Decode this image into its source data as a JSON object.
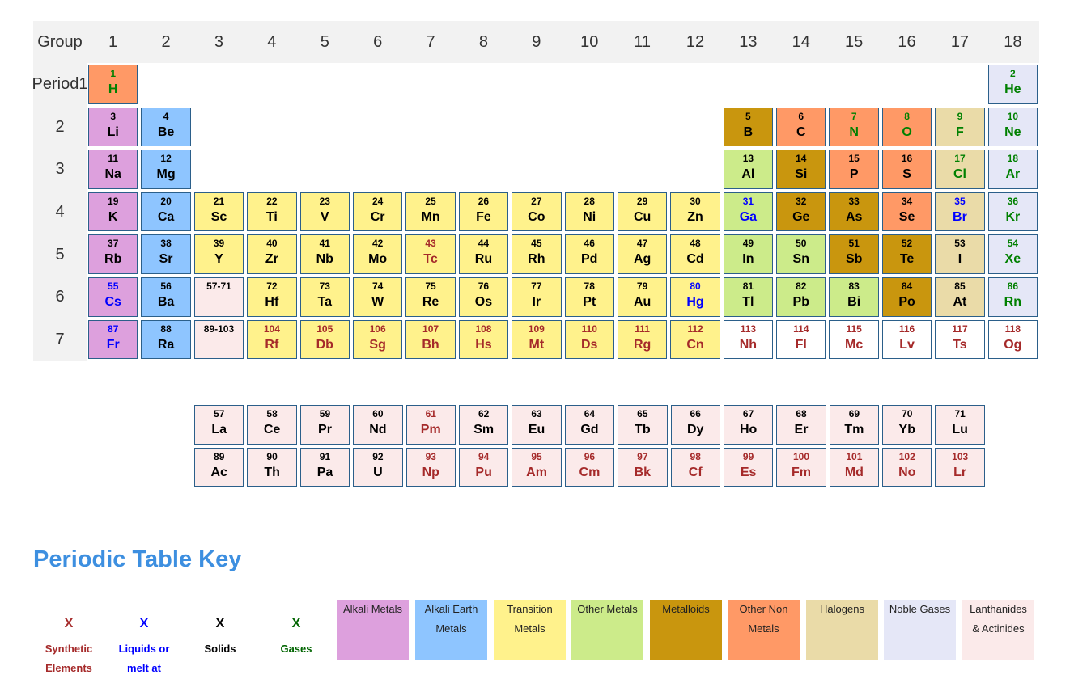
{
  "header": {
    "group_label": "Group",
    "period_label": "Period"
  },
  "groups": [
    "1",
    "2",
    "3",
    "4",
    "5",
    "6",
    "7",
    "8",
    "9",
    "10",
    "11",
    "12",
    "13",
    "14",
    "15",
    "16",
    "17",
    "18"
  ],
  "periods": [
    "1",
    "2",
    "3",
    "4",
    "5",
    "6",
    "7"
  ],
  "category_colors": {
    "alkali": "#dda0dd",
    "alkaline": "#8ec5ff",
    "transition": "#fff28c",
    "other_metal": "#cceb8a",
    "metalloid": "#c9960e",
    "nonmetal": "#ff9966",
    "halogen": "#eadba8",
    "noble": "#e5e7f7",
    "lanthanide": "#fbeaea",
    "synthetic_cell": "#ffffff"
  },
  "state_colors": {
    "solid": "#000000",
    "liquid": "#0000ff",
    "gas": "#008000",
    "synthetic": "#a52a2a"
  },
  "elements": [
    {
      "n": "1",
      "s": "H",
      "g": 1,
      "p": 1,
      "c": "nonmetal",
      "st": "gas"
    },
    {
      "n": "2",
      "s": "He",
      "g": 18,
      "p": 1,
      "c": "noble",
      "st": "gas"
    },
    {
      "n": "3",
      "s": "Li",
      "g": 1,
      "p": 2,
      "c": "alkali",
      "st": "solid"
    },
    {
      "n": "4",
      "s": "Be",
      "g": 2,
      "p": 2,
      "c": "alkaline",
      "st": "solid"
    },
    {
      "n": "5",
      "s": "B",
      "g": 13,
      "p": 2,
      "c": "metalloid",
      "st": "solid"
    },
    {
      "n": "6",
      "s": "C",
      "g": 14,
      "p": 2,
      "c": "nonmetal",
      "st": "solid"
    },
    {
      "n": "7",
      "s": "N",
      "g": 15,
      "p": 2,
      "c": "nonmetal",
      "st": "gas"
    },
    {
      "n": "8",
      "s": "O",
      "g": 16,
      "p": 2,
      "c": "nonmetal",
      "st": "gas"
    },
    {
      "n": "9",
      "s": "F",
      "g": 17,
      "p": 2,
      "c": "halogen",
      "st": "gas"
    },
    {
      "n": "10",
      "s": "Ne",
      "g": 18,
      "p": 2,
      "c": "noble",
      "st": "gas"
    },
    {
      "n": "11",
      "s": "Na",
      "g": 1,
      "p": 3,
      "c": "alkali",
      "st": "solid"
    },
    {
      "n": "12",
      "s": "Mg",
      "g": 2,
      "p": 3,
      "c": "alkaline",
      "st": "solid"
    },
    {
      "n": "13",
      "s": "Al",
      "g": 13,
      "p": 3,
      "c": "other_metal",
      "st": "solid"
    },
    {
      "n": "14",
      "s": "Si",
      "g": 14,
      "p": 3,
      "c": "metalloid",
      "st": "solid"
    },
    {
      "n": "15",
      "s": "P",
      "g": 15,
      "p": 3,
      "c": "nonmetal",
      "st": "solid"
    },
    {
      "n": "16",
      "s": "S",
      "g": 16,
      "p": 3,
      "c": "nonmetal",
      "st": "solid"
    },
    {
      "n": "17",
      "s": "Cl",
      "g": 17,
      "p": 3,
      "c": "halogen",
      "st": "gas"
    },
    {
      "n": "18",
      "s": "Ar",
      "g": 18,
      "p": 3,
      "c": "noble",
      "st": "gas"
    },
    {
      "n": "19",
      "s": "K",
      "g": 1,
      "p": 4,
      "c": "alkali",
      "st": "solid"
    },
    {
      "n": "20",
      "s": "Ca",
      "g": 2,
      "p": 4,
      "c": "alkaline",
      "st": "solid"
    },
    {
      "n": "21",
      "s": "Sc",
      "g": 3,
      "p": 4,
      "c": "transition",
      "st": "solid"
    },
    {
      "n": "22",
      "s": "Ti",
      "g": 4,
      "p": 4,
      "c": "transition",
      "st": "solid"
    },
    {
      "n": "23",
      "s": "V",
      "g": 5,
      "p": 4,
      "c": "transition",
      "st": "solid"
    },
    {
      "n": "24",
      "s": "Cr",
      "g": 6,
      "p": 4,
      "c": "transition",
      "st": "solid"
    },
    {
      "n": "25",
      "s": "Mn",
      "g": 7,
      "p": 4,
      "c": "transition",
      "st": "solid"
    },
    {
      "n": "26",
      "s": "Fe",
      "g": 8,
      "p": 4,
      "c": "transition",
      "st": "solid"
    },
    {
      "n": "27",
      "s": "Co",
      "g": 9,
      "p": 4,
      "c": "transition",
      "st": "solid"
    },
    {
      "n": "28",
      "s": "Ni",
      "g": 10,
      "p": 4,
      "c": "transition",
      "st": "solid"
    },
    {
      "n": "29",
      "s": "Cu",
      "g": 11,
      "p": 4,
      "c": "transition",
      "st": "solid"
    },
    {
      "n": "30",
      "s": "Zn",
      "g": 12,
      "p": 4,
      "c": "transition",
      "st": "solid"
    },
    {
      "n": "31",
      "s": "Ga",
      "g": 13,
      "p": 4,
      "c": "other_metal",
      "st": "liquid"
    },
    {
      "n": "32",
      "s": "Ge",
      "g": 14,
      "p": 4,
      "c": "metalloid",
      "st": "solid"
    },
    {
      "n": "33",
      "s": "As",
      "g": 15,
      "p": 4,
      "c": "metalloid",
      "st": "solid"
    },
    {
      "n": "34",
      "s": "Se",
      "g": 16,
      "p": 4,
      "c": "nonmetal",
      "st": "solid"
    },
    {
      "n": "35",
      "s": "Br",
      "g": 17,
      "p": 4,
      "c": "halogen",
      "st": "liquid"
    },
    {
      "n": "36",
      "s": "Kr",
      "g": 18,
      "p": 4,
      "c": "noble",
      "st": "gas"
    },
    {
      "n": "37",
      "s": "Rb",
      "g": 1,
      "p": 5,
      "c": "alkali",
      "st": "solid"
    },
    {
      "n": "38",
      "s": "Sr",
      "g": 2,
      "p": 5,
      "c": "alkaline",
      "st": "solid"
    },
    {
      "n": "39",
      "s": "Y",
      "g": 3,
      "p": 5,
      "c": "transition",
      "st": "solid"
    },
    {
      "n": "40",
      "s": "Zr",
      "g": 4,
      "p": 5,
      "c": "transition",
      "st": "solid"
    },
    {
      "n": "41",
      "s": "Nb",
      "g": 5,
      "p": 5,
      "c": "transition",
      "st": "solid"
    },
    {
      "n": "42",
      "s": "Mo",
      "g": 6,
      "p": 5,
      "c": "transition",
      "st": "solid"
    },
    {
      "n": "43",
      "s": "Tc",
      "g": 7,
      "p": 5,
      "c": "transition",
      "st": "synthetic"
    },
    {
      "n": "44",
      "s": "Ru",
      "g": 8,
      "p": 5,
      "c": "transition",
      "st": "solid"
    },
    {
      "n": "45",
      "s": "Rh",
      "g": 9,
      "p": 5,
      "c": "transition",
      "st": "solid"
    },
    {
      "n": "46",
      "s": "Pd",
      "g": 10,
      "p": 5,
      "c": "transition",
      "st": "solid"
    },
    {
      "n": "47",
      "s": "Ag",
      "g": 11,
      "p": 5,
      "c": "transition",
      "st": "solid"
    },
    {
      "n": "48",
      "s": "Cd",
      "g": 12,
      "p": 5,
      "c": "transition",
      "st": "solid"
    },
    {
      "n": "49",
      "s": "In",
      "g": 13,
      "p": 5,
      "c": "other_metal",
      "st": "solid"
    },
    {
      "n": "50",
      "s": "Sn",
      "g": 14,
      "p": 5,
      "c": "other_metal",
      "st": "solid"
    },
    {
      "n": "51",
      "s": "Sb",
      "g": 15,
      "p": 5,
      "c": "metalloid",
      "st": "solid"
    },
    {
      "n": "52",
      "s": "Te",
      "g": 16,
      "p": 5,
      "c": "metalloid",
      "st": "solid"
    },
    {
      "n": "53",
      "s": "I",
      "g": 17,
      "p": 5,
      "c": "halogen",
      "st": "solid"
    },
    {
      "n": "54",
      "s": "Xe",
      "g": 18,
      "p": 5,
      "c": "noble",
      "st": "gas"
    },
    {
      "n": "55",
      "s": "Cs",
      "g": 1,
      "p": 6,
      "c": "alkali",
      "st": "liquid"
    },
    {
      "n": "56",
      "s": "Ba",
      "g": 2,
      "p": 6,
      "c": "alkaline",
      "st": "solid"
    },
    {
      "n": "57-71",
      "s": "",
      "g": 3,
      "p": 6,
      "c": "lanthanide",
      "st": "solid"
    },
    {
      "n": "72",
      "s": "Hf",
      "g": 4,
      "p": 6,
      "c": "transition",
      "st": "solid"
    },
    {
      "n": "73",
      "s": "Ta",
      "g": 5,
      "p": 6,
      "c": "transition",
      "st": "solid"
    },
    {
      "n": "74",
      "s": "W",
      "g": 6,
      "p": 6,
      "c": "transition",
      "st": "solid"
    },
    {
      "n": "75",
      "s": "Re",
      "g": 7,
      "p": 6,
      "c": "transition",
      "st": "solid"
    },
    {
      "n": "76",
      "s": "Os",
      "g": 8,
      "p": 6,
      "c": "transition",
      "st": "solid"
    },
    {
      "n": "77",
      "s": "Ir",
      "g": 9,
      "p": 6,
      "c": "transition",
      "st": "solid"
    },
    {
      "n": "78",
      "s": "Pt",
      "g": 10,
      "p": 6,
      "c": "transition",
      "st": "solid"
    },
    {
      "n": "79",
      "s": "Au",
      "g": 11,
      "p": 6,
      "c": "transition",
      "st": "solid"
    },
    {
      "n": "80",
      "s": "Hg",
      "g": 12,
      "p": 6,
      "c": "transition",
      "st": "liquid"
    },
    {
      "n": "81",
      "s": "Tl",
      "g": 13,
      "p": 6,
      "c": "other_metal",
      "st": "solid"
    },
    {
      "n": "82",
      "s": "Pb",
      "g": 14,
      "p": 6,
      "c": "other_metal",
      "st": "solid"
    },
    {
      "n": "83",
      "s": "Bi",
      "g": 15,
      "p": 6,
      "c": "other_metal",
      "st": "solid"
    },
    {
      "n": "84",
      "s": "Po",
      "g": 16,
      "p": 6,
      "c": "metalloid",
      "st": "solid"
    },
    {
      "n": "85",
      "s": "At",
      "g": 17,
      "p": 6,
      "c": "halogen",
      "st": "solid"
    },
    {
      "n": "86",
      "s": "Rn",
      "g": 18,
      "p": 6,
      "c": "noble",
      "st": "gas"
    },
    {
      "n": "87",
      "s": "Fr",
      "g": 1,
      "p": 7,
      "c": "alkali",
      "st": "liquid"
    },
    {
      "n": "88",
      "s": "Ra",
      "g": 2,
      "p": 7,
      "c": "alkaline",
      "st": "solid"
    },
    {
      "n": "89-103",
      "s": "",
      "g": 3,
      "p": 7,
      "c": "lanthanide",
      "st": "solid"
    },
    {
      "n": "104",
      "s": "Rf",
      "g": 4,
      "p": 7,
      "c": "transition",
      "st": "synthetic"
    },
    {
      "n": "105",
      "s": "Db",
      "g": 5,
      "p": 7,
      "c": "transition",
      "st": "synthetic"
    },
    {
      "n": "106",
      "s": "Sg",
      "g": 6,
      "p": 7,
      "c": "transition",
      "st": "synthetic"
    },
    {
      "n": "107",
      "s": "Bh",
      "g": 7,
      "p": 7,
      "c": "transition",
      "st": "synthetic"
    },
    {
      "n": "108",
      "s": "Hs",
      "g": 8,
      "p": 7,
      "c": "transition",
      "st": "synthetic"
    },
    {
      "n": "109",
      "s": "Mt",
      "g": 9,
      "p": 7,
      "c": "transition",
      "st": "synthetic"
    },
    {
      "n": "110",
      "s": "Ds",
      "g": 10,
      "p": 7,
      "c": "transition",
      "st": "synthetic"
    },
    {
      "n": "111",
      "s": "Rg",
      "g": 11,
      "p": 7,
      "c": "transition",
      "st": "synthetic"
    },
    {
      "n": "112",
      "s": "Cn",
      "g": 12,
      "p": 7,
      "c": "transition",
      "st": "synthetic"
    },
    {
      "n": "113",
      "s": "Nh",
      "g": 13,
      "p": 7,
      "c": "synthetic_cell",
      "st": "synthetic"
    },
    {
      "n": "114",
      "s": "Fl",
      "g": 14,
      "p": 7,
      "c": "synthetic_cell",
      "st": "synthetic"
    },
    {
      "n": "115",
      "s": "Mc",
      "g": 15,
      "p": 7,
      "c": "synthetic_cell",
      "st": "synthetic"
    },
    {
      "n": "116",
      "s": "Lv",
      "g": 16,
      "p": 7,
      "c": "synthetic_cell",
      "st": "synthetic"
    },
    {
      "n": "117",
      "s": "Ts",
      "g": 17,
      "p": 7,
      "c": "synthetic_cell",
      "st": "synthetic"
    },
    {
      "n": "118",
      "s": "Og",
      "g": 18,
      "p": 7,
      "c": "synthetic_cell",
      "st": "synthetic"
    }
  ],
  "lanthanides": [
    {
      "n": "57",
      "s": "La",
      "st": "solid"
    },
    {
      "n": "58",
      "s": "Ce",
      "st": "solid"
    },
    {
      "n": "59",
      "s": "Pr",
      "st": "solid"
    },
    {
      "n": "60",
      "s": "Nd",
      "st": "solid"
    },
    {
      "n": "61",
      "s": "Pm",
      "st": "synthetic"
    },
    {
      "n": "62",
      "s": "Sm",
      "st": "solid"
    },
    {
      "n": "63",
      "s": "Eu",
      "st": "solid"
    },
    {
      "n": "64",
      "s": "Gd",
      "st": "solid"
    },
    {
      "n": "65",
      "s": "Tb",
      "st": "solid"
    },
    {
      "n": "66",
      "s": "Dy",
      "st": "solid"
    },
    {
      "n": "67",
      "s": "Ho",
      "st": "solid"
    },
    {
      "n": "68",
      "s": "Er",
      "st": "solid"
    },
    {
      "n": "69",
      "s": "Tm",
      "st": "solid"
    },
    {
      "n": "70",
      "s": "Yb",
      "st": "solid"
    },
    {
      "n": "71",
      "s": "Lu",
      "st": "solid"
    }
  ],
  "actinides": [
    {
      "n": "89",
      "s": "Ac",
      "st": "solid"
    },
    {
      "n": "90",
      "s": "Th",
      "st": "solid"
    },
    {
      "n": "91",
      "s": "Pa",
      "st": "solid"
    },
    {
      "n": "92",
      "s": "U",
      "st": "solid"
    },
    {
      "n": "93",
      "s": "Np",
      "st": "synthetic"
    },
    {
      "n": "94",
      "s": "Pu",
      "st": "synthetic"
    },
    {
      "n": "95",
      "s": "Am",
      "st": "synthetic"
    },
    {
      "n": "96",
      "s": "Cm",
      "st": "synthetic"
    },
    {
      "n": "97",
      "s": "Bk",
      "st": "synthetic"
    },
    {
      "n": "98",
      "s": "Cf",
      "st": "synthetic"
    },
    {
      "n": "99",
      "s": "Es",
      "st": "synthetic"
    },
    {
      "n": "100",
      "s": "Fm",
      "st": "synthetic"
    },
    {
      "n": "101",
      "s": "Md",
      "st": "synthetic"
    },
    {
      "n": "102",
      "s": "No",
      "st": "synthetic"
    },
    {
      "n": "103",
      "s": "Lr",
      "st": "synthetic"
    }
  ],
  "key": {
    "title": "Periodic Table Key",
    "states": [
      {
        "x": "X",
        "line1": "Synthetic",
        "line2": "Elements",
        "color": "#a52a2a"
      },
      {
        "x": "X",
        "line1": "Liquids or",
        "line2": "melt at",
        "color": "#0000ff"
      },
      {
        "x": "X",
        "line1": "Solids",
        "line2": "",
        "color": "#000000"
      },
      {
        "x": "X",
        "line1": "Gases",
        "line2": "",
        "color": "#006400"
      }
    ],
    "categories": [
      {
        "label1": "Alkali Metals",
        "label2": "",
        "color": "#dda0dd"
      },
      {
        "label1": "Alkali Earth",
        "label2": "Metals",
        "color": "#8ec5ff"
      },
      {
        "label1": "Transition",
        "label2": "Metals",
        "color": "#fff28c"
      },
      {
        "label1": "Other Metals",
        "label2": "",
        "color": "#cceb8a"
      },
      {
        "label1": "Metalloids",
        "label2": "",
        "color": "#c9960e"
      },
      {
        "label1": "Other Non",
        "label2": "Metals",
        "color": "#ff9966"
      },
      {
        "label1": "Halogens",
        "label2": "",
        "color": "#eadba8"
      },
      {
        "label1": "Noble Gases",
        "label2": "",
        "color": "#e5e7f7"
      },
      {
        "label1": "Lanthanides",
        "label2": "& Actinides",
        "color": "#fbeaea"
      }
    ]
  }
}
